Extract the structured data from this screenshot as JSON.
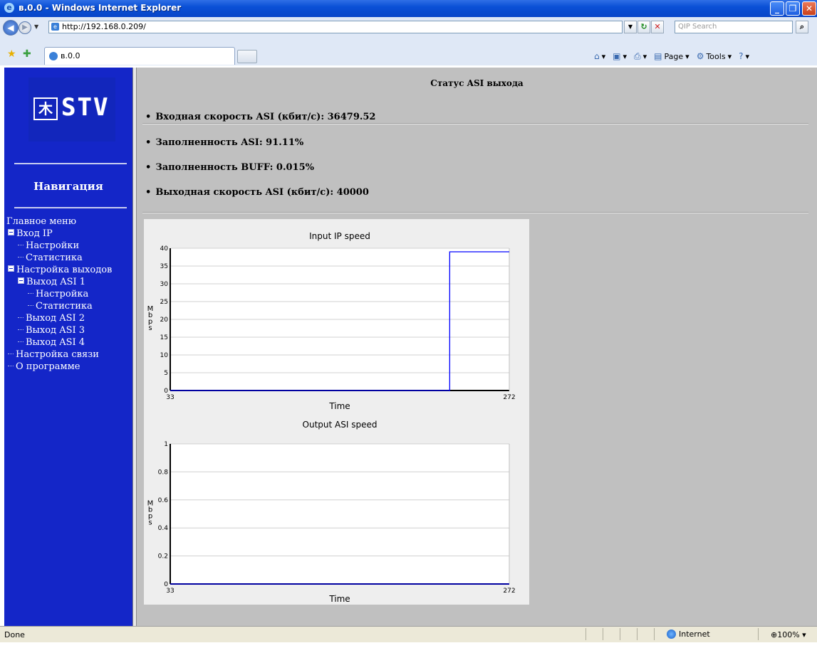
{
  "window": {
    "title": "в.0.0 - Windows Internet Explorer"
  },
  "address": {
    "url": "http://192.168.0.209/",
    "search_placeholder": "QIP Search"
  },
  "tab": {
    "label": "в.0.0"
  },
  "commands": {
    "page": "Page",
    "tools": "Tools"
  },
  "sidebar": {
    "nav_title": "Навигация",
    "tree": [
      {
        "label": "Главное меню",
        "level": 0,
        "marker": "none"
      },
      {
        "label": "Вход IP",
        "level": 0,
        "marker": "box"
      },
      {
        "label": "Настройки",
        "level": 1,
        "marker": "line"
      },
      {
        "label": "Статистика",
        "level": 1,
        "marker": "line"
      },
      {
        "label": "Настройка выходов",
        "level": 0,
        "marker": "box"
      },
      {
        "label": "Выход ASI 1",
        "level": 1,
        "marker": "box"
      },
      {
        "label": "Настройка",
        "level": 2,
        "marker": "line"
      },
      {
        "label": "Статистика",
        "level": 2,
        "marker": "line"
      },
      {
        "label": "Выход ASI 2",
        "level": 1,
        "marker": "line"
      },
      {
        "label": "Выход ASI 3",
        "level": 1,
        "marker": "line"
      },
      {
        "label": "Выход ASI 4",
        "level": 1,
        "marker": "line"
      },
      {
        "label": "Настройка связи",
        "level": 0,
        "marker": "line"
      },
      {
        "label": "О программе",
        "level": 0,
        "marker": "line"
      }
    ]
  },
  "main": {
    "heading": "Статус ASI выхода",
    "stats": [
      "Входная скорость ASI (кбит/с): 36479.52",
      "Заполненность ASI: 91.11%",
      "Заполненность BUFF: 0.015%",
      "Выходная скорость ASI (кбит/с): 40000"
    ]
  },
  "chart_data": [
    {
      "type": "line",
      "title": "Input IP speed",
      "xlabel": "Time",
      "ylabel": "Mbps",
      "xlim": [
        33,
        272
      ],
      "ylim": [
        0,
        40
      ],
      "yticks": [
        0,
        5,
        10,
        15,
        20,
        25,
        30,
        35,
        40
      ],
      "xtick_labels": [
        "33",
        "272"
      ],
      "grid": true,
      "color": "#0000ff",
      "series": [
        {
          "x": [
            33,
            230,
            230,
            272
          ],
          "y": [
            0,
            0,
            39,
            39
          ]
        }
      ]
    },
    {
      "type": "line",
      "title": "Output ASI speed",
      "xlabel": "Time",
      "ylabel": "Mbps",
      "xlim": [
        33,
        272
      ],
      "ylim": [
        0,
        1
      ],
      "yticks": [
        0,
        0.2,
        0.4,
        0.6,
        0.8,
        1
      ],
      "xtick_labels": [
        "33",
        "272"
      ],
      "grid": true,
      "color": "#0000ff",
      "series": [
        {
          "x": [
            33,
            272
          ],
          "y": [
            0,
            0
          ]
        }
      ]
    }
  ],
  "status": {
    "text": "Done",
    "zone": "Internet",
    "zoom": "100%"
  }
}
